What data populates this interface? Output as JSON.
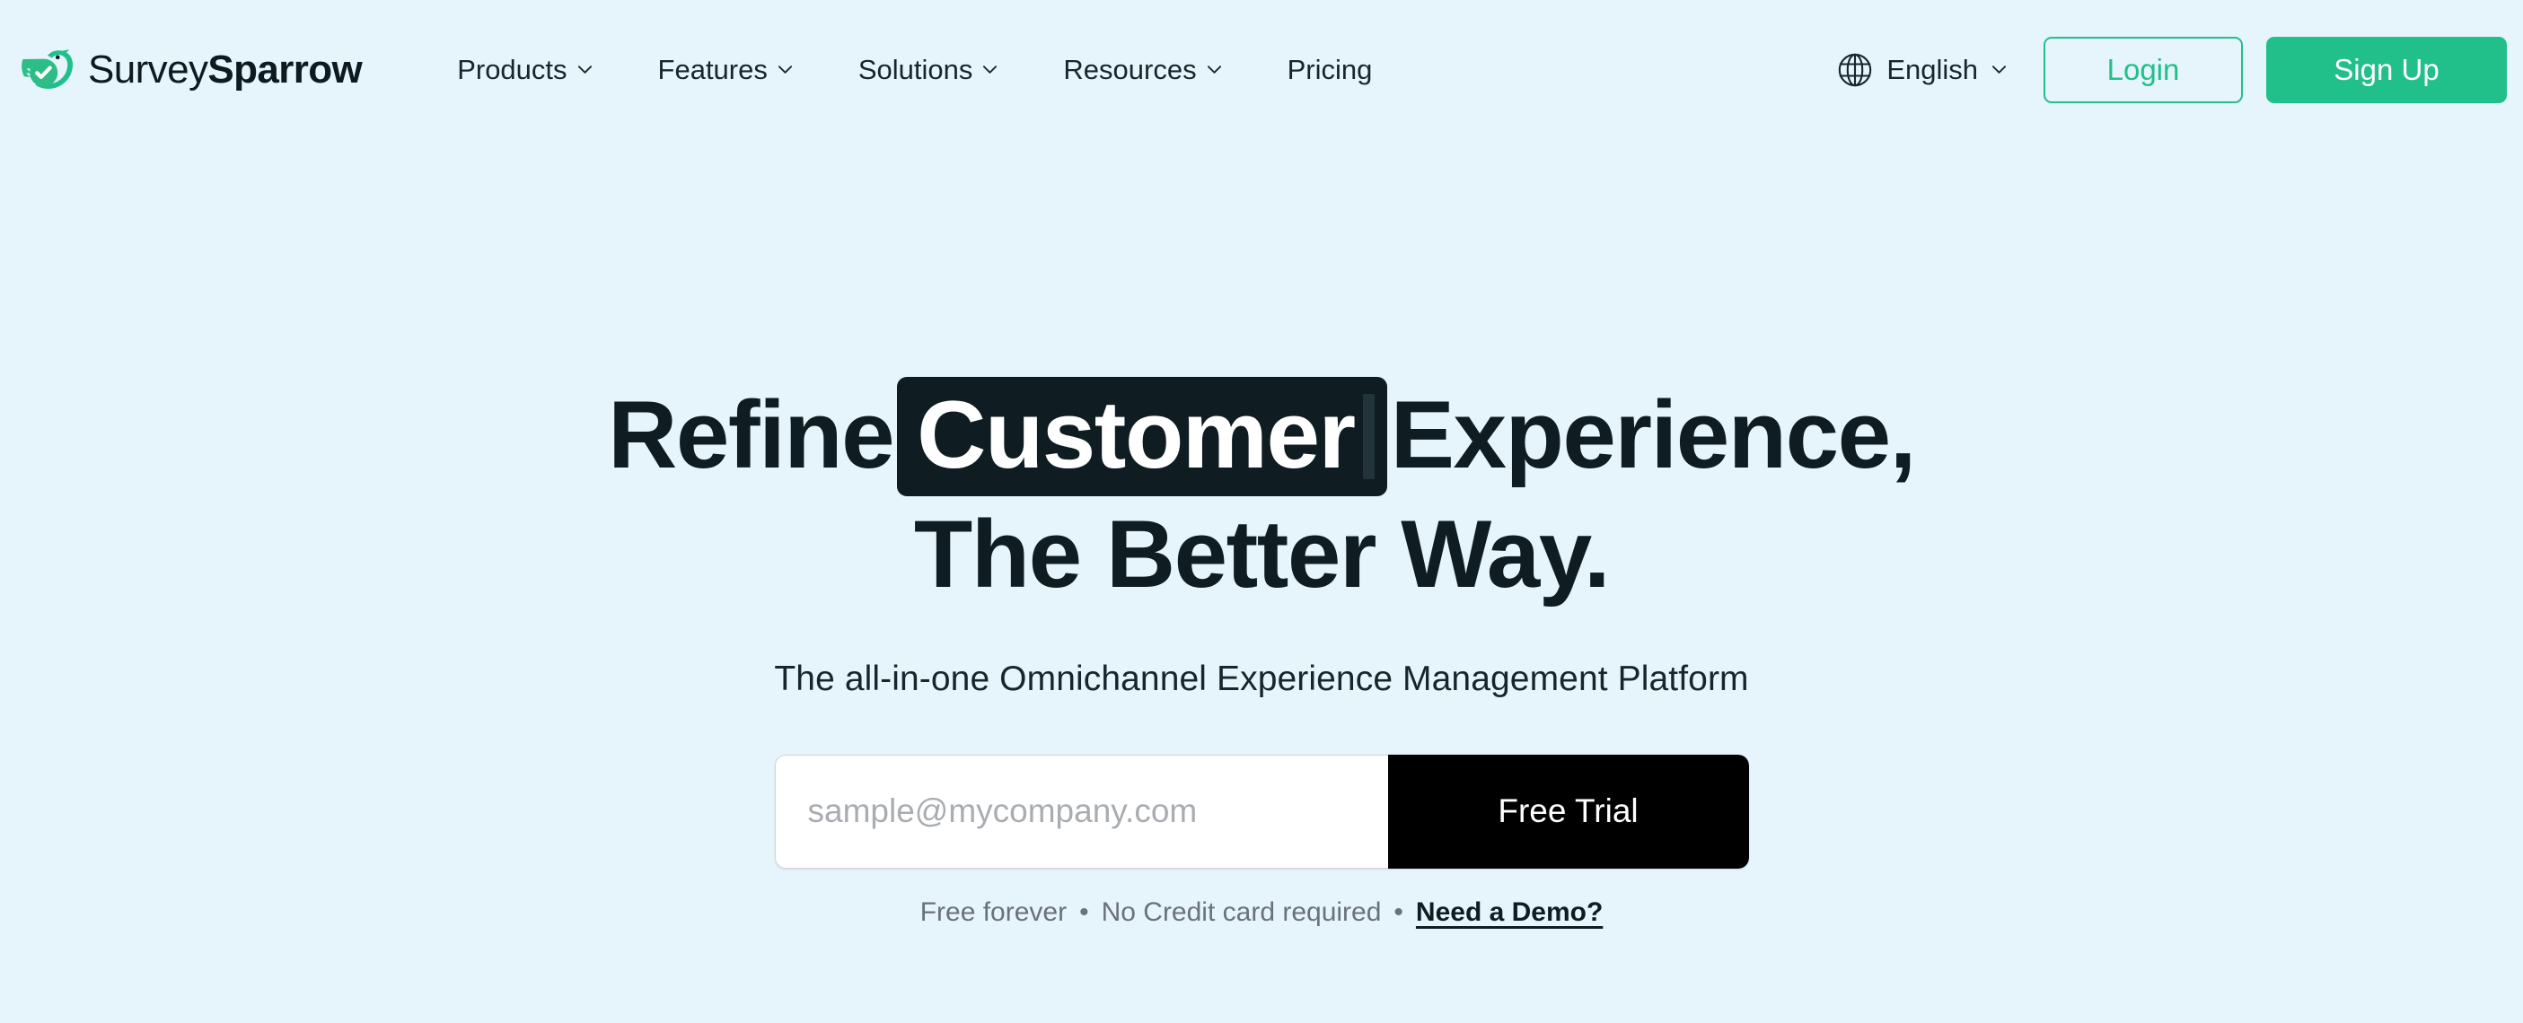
{
  "colors": {
    "page_background": "#E6F4FC",
    "brand_green": "#21C08A",
    "dark_navy": "#0F1D23",
    "button_black": "#000000",
    "muted_text": "#6A7279",
    "placeholder_text": "#A9ADB2"
  },
  "header": {
    "logo": {
      "icon": "sparrow-bird-check-icon",
      "wordmark_light": "Survey",
      "wordmark_bold": "Sparrow"
    },
    "nav_items": [
      {
        "label": "Products",
        "has_dropdown": true,
        "icon": "chevron-down-icon"
      },
      {
        "label": "Features",
        "has_dropdown": true,
        "icon": "chevron-down-icon"
      },
      {
        "label": "Solutions",
        "has_dropdown": true,
        "icon": "chevron-down-icon"
      },
      {
        "label": "Resources",
        "has_dropdown": true,
        "icon": "chevron-down-icon"
      },
      {
        "label": "Pricing",
        "has_dropdown": false,
        "icon": ""
      }
    ],
    "language": {
      "icon": "globe-icon",
      "label": "English",
      "chevron": "chevron-down-icon"
    },
    "login_label": "Login",
    "signup_label": "Sign Up"
  },
  "hero": {
    "title_line1_before": "Refine",
    "title_highlight": "Customer",
    "title_line1_after": "Experience,",
    "title_line2": "The Better Way.",
    "subtitle": "The all-in-one Omnichannel Experience Management Platform",
    "email_placeholder": "sample@mycompany.com",
    "email_value": "",
    "cta_label": "Free Trial",
    "fineprint": {
      "item1": "Free forever",
      "separator1": "•",
      "item2": "No Credit card required",
      "separator2": "•",
      "demo_link": "Need a Demo?"
    }
  }
}
